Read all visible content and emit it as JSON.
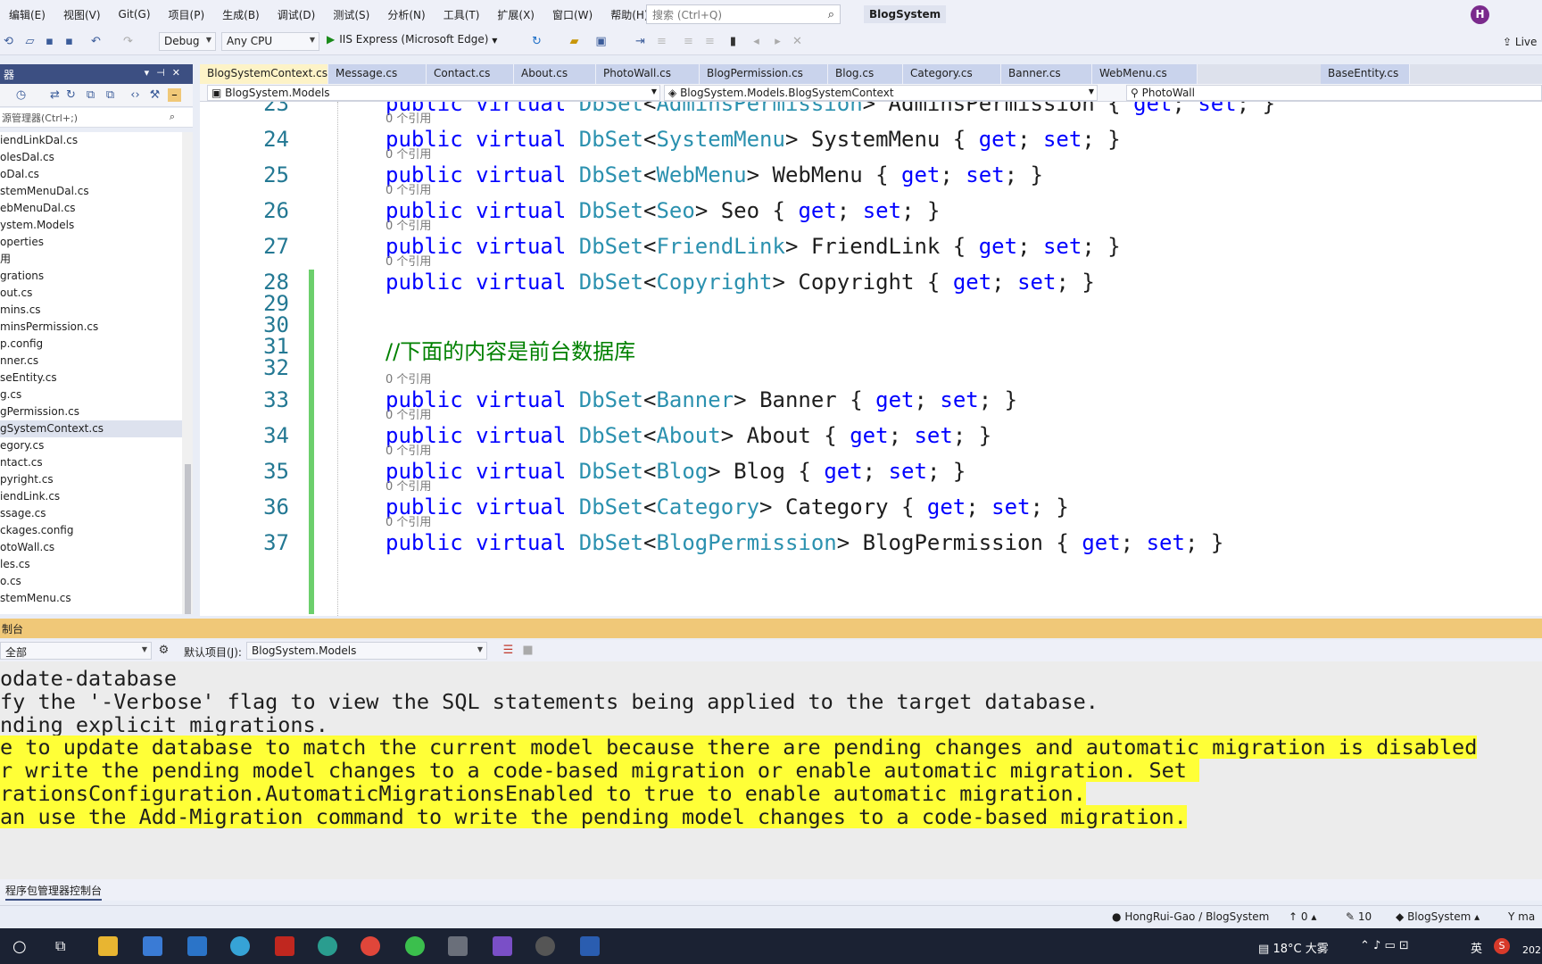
{
  "menubar": {
    "items": [
      "编辑(E)",
      "视图(V)",
      "Git(G)",
      "项目(P)",
      "生成(B)",
      "调试(D)",
      "测试(S)",
      "分析(N)",
      "工具(T)",
      "扩展(X)",
      "窗口(W)",
      "帮助(H)"
    ],
    "search_placeholder": "搜索 (Ctrl+Q)",
    "app_title": "BlogSystem",
    "avatar_letter": "H"
  },
  "toolbar": {
    "config": "Debug",
    "platform": "Any CPU",
    "run_label": "IIS Express (Microsoft Edge)",
    "live_share": "Live"
  },
  "solution_explorer": {
    "title": "器",
    "search_placeholder": "源管理器(Ctrl+;)",
    "files": [
      {
        "name": "iendLinkDal.cs",
        "selected": false
      },
      {
        "name": "olesDal.cs",
        "selected": false
      },
      {
        "name": "oDal.cs",
        "selected": false
      },
      {
        "name": "stemMenuDal.cs",
        "selected": false
      },
      {
        "name": "ebMenuDal.cs",
        "selected": false
      },
      {
        "name": "ystem.Models",
        "selected": false
      },
      {
        "name": "operties",
        "selected": false
      },
      {
        "name": "用",
        "selected": false
      },
      {
        "name": "grations",
        "selected": false
      },
      {
        "name": "out.cs",
        "selected": false
      },
      {
        "name": "mins.cs",
        "selected": false
      },
      {
        "name": "minsPermission.cs",
        "selected": false
      },
      {
        "name": "p.config",
        "selected": false
      },
      {
        "name": "nner.cs",
        "selected": false
      },
      {
        "name": "seEntity.cs",
        "selected": false
      },
      {
        "name": "g.cs",
        "selected": false
      },
      {
        "name": "gPermission.cs",
        "selected": false
      },
      {
        "name": "gSystemContext.cs",
        "selected": true
      },
      {
        "name": "egory.cs",
        "selected": false
      },
      {
        "name": "ntact.cs",
        "selected": false
      },
      {
        "name": "pyright.cs",
        "selected": false
      },
      {
        "name": "iendLink.cs",
        "selected": false
      },
      {
        "name": "ssage.cs",
        "selected": false
      },
      {
        "name": "ckages.config",
        "selected": false
      },
      {
        "name": "otoWall.cs",
        "selected": false
      },
      {
        "name": "les.cs",
        "selected": false
      },
      {
        "name": "o.cs",
        "selected": false
      },
      {
        "name": "stemMenu.cs",
        "selected": false
      }
    ]
  },
  "tabs": [
    {
      "label": "BlogSystemContext.cs",
      "active": true,
      "pin": "⊣ ✕"
    },
    {
      "label": "Message.cs",
      "active": false
    },
    {
      "label": "Contact.cs",
      "active": false
    },
    {
      "label": "About.cs",
      "active": false
    },
    {
      "label": "PhotoWall.cs",
      "active": false
    },
    {
      "label": "BlogPermission.cs",
      "active": false
    },
    {
      "label": "Blog.cs",
      "active": false
    },
    {
      "label": "Category.cs",
      "active": false
    },
    {
      "label": "Banner.cs",
      "active": false
    },
    {
      "label": "WebMenu.cs",
      "active": false
    },
    {
      "label": "BaseEntity.cs",
      "active": false
    }
  ],
  "navbar": {
    "project": "BlogSystem.Models",
    "type": "BlogSystem.Models.BlogSystemContext",
    "member": "PhotoWall"
  },
  "editor": {
    "refs_label": "0 个引用",
    "lines": [
      {
        "num": "23",
        "kind": "prop",
        "type": "AdminsPermission",
        "name": "AdminsPermission",
        "refs": false
      },
      {
        "num": "24",
        "kind": "prop",
        "type": "SystemMenu",
        "name": "SystemMenu",
        "refs": true
      },
      {
        "num": "25",
        "kind": "prop",
        "type": "WebMenu",
        "name": "WebMenu",
        "refs": true
      },
      {
        "num": "26",
        "kind": "prop",
        "type": "Seo",
        "name": "Seo",
        "refs": true
      },
      {
        "num": "27",
        "kind": "prop",
        "type": "FriendLink",
        "name": "FriendLink",
        "refs": true
      },
      {
        "num": "28",
        "kind": "prop",
        "type": "Copyright",
        "name": "Copyright",
        "refs": true
      },
      {
        "num": "29",
        "kind": "blank"
      },
      {
        "num": "30",
        "kind": "blank"
      },
      {
        "num": "31",
        "kind": "comment",
        "text": "//下面的内容是前台数据库"
      },
      {
        "num": "32",
        "kind": "blank"
      },
      {
        "num": "33",
        "kind": "prop",
        "type": "Banner",
        "name": "Banner",
        "refs": true
      },
      {
        "num": "34",
        "kind": "prop",
        "type": "About",
        "name": "About",
        "refs": true
      },
      {
        "num": "35",
        "kind": "prop",
        "type": "Blog",
        "name": "Blog",
        "refs": true
      },
      {
        "num": "36",
        "kind": "prop",
        "type": "Category",
        "name": "Category",
        "refs": true
      },
      {
        "num": "37",
        "kind": "prop",
        "type": "BlogPermission",
        "name": "BlogPermission",
        "refs": true
      }
    ]
  },
  "console": {
    "title": "制台",
    "source_label": "全部",
    "default_project_label": "默认项目(J):",
    "default_project": "BlogSystem.Models",
    "lines": [
      {
        "text": "odate-database",
        "warn": false
      },
      {
        "text": "fy the '-Verbose' flag to view the SQL statements being applied to the target database.",
        "warn": false
      },
      {
        "text": "nding explicit migrations.",
        "warn": false
      },
      {
        "text": "e to update database to match the current model because there are pending changes and automatic migration is disabled",
        "warn": true
      },
      {
        "text": "r write the pending model changes to a code-based migration or enable automatic migration. Set ",
        "warn": true
      },
      {
        "text": "rationsConfiguration.AutomaticMigrationsEnabled to true to enable automatic migration.",
        "warn": true
      },
      {
        "text": "an use the Add-Migration command to write the pending model changes to a code-based migration.",
        "warn": true
      }
    ],
    "tab_label": "程序包管理器控制台"
  },
  "statusbar": {
    "repo": "HongRui-Gao / BlogSystem",
    "push_count": "0",
    "edits": "10",
    "branch": "BlogSystem",
    "git_label": "ma"
  },
  "taskbar": {
    "weather": "18°C 大雾",
    "ime": "英",
    "year_partial": "202"
  }
}
